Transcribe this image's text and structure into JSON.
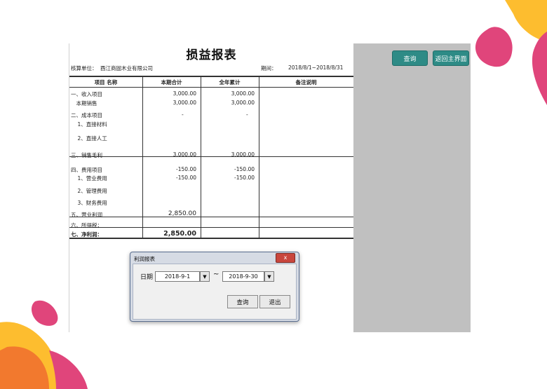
{
  "report": {
    "title": "损益报表",
    "unit_label": "核算单位：",
    "unit_name": "酉江商固木业有限公司",
    "period_label": "期间：",
    "period_value": "2018/8/1~2018/8/31",
    "headers": [
      "项目 名称",
      "本期合计",
      "全年累计",
      "备注说明"
    ],
    "rows": [
      {
        "name": "一、收入项目",
        "current": "3,000.00",
        "annual": "3,000.00"
      },
      {
        "name": "　本期销售",
        "current": "3,000.00",
        "annual": "3,000.00"
      },
      {
        "name": "二、成本项目",
        "current": "-",
        "annual": "-"
      },
      {
        "name": "　1、直接材料",
        "current": "",
        "annual": ""
      },
      {
        "name": "　2、直接人工",
        "current": "",
        "annual": ""
      },
      {
        "name": "三、销售毛利",
        "current": "3,000.00",
        "annual": "3,000.00"
      },
      {
        "name": "四、费用项目",
        "current": "-150.00",
        "annual": "-150.00"
      },
      {
        "name": "　1、营业费用",
        "current": "-150.00",
        "annual": "-150.00"
      },
      {
        "name": "　2、管理费用",
        "current": "",
        "annual": ""
      },
      {
        "name": "　3、财务费用",
        "current": "",
        "annual": ""
      },
      {
        "name": "五、营业利润",
        "current": "2,850.00",
        "annual": ""
      },
      {
        "name": "六、所得税：",
        "current": "",
        "annual": ""
      },
      {
        "name": "七、净利润：",
        "current": "2,850.00",
        "annual": ""
      }
    ]
  },
  "actions": {
    "query_label": "查询",
    "back_label": "返回主界面"
  },
  "dialog": {
    "title": "利润报表",
    "close_label": "x",
    "date_label": "日期",
    "date_from": "2018-9-1",
    "date_to": "2018-9-30",
    "tilde": "~",
    "dropdown_glyph": "▼",
    "query_label": "查询",
    "exit_label": "退出"
  },
  "colors": {
    "accent_green": "#2e8b86",
    "panel_gray": "#c0c0c0",
    "deco_pink": "#e0457b",
    "deco_yellow": "#fdbd2f"
  }
}
